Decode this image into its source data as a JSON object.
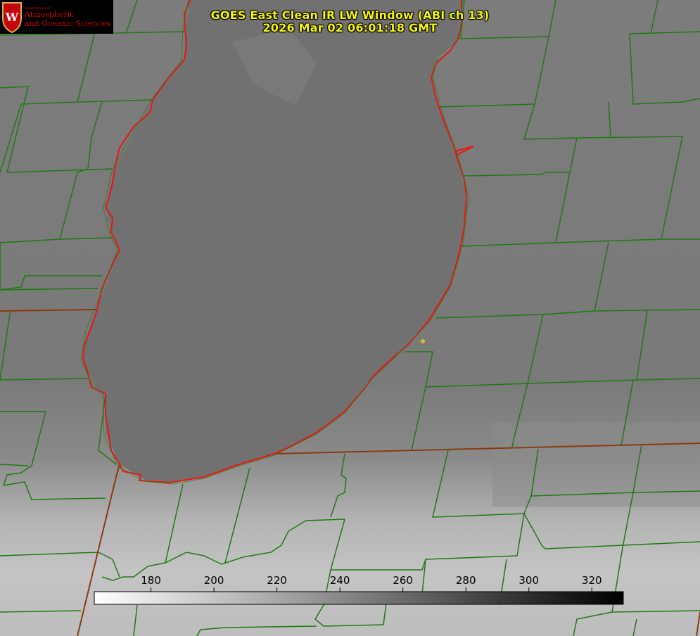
{
  "title": {
    "line1": "GOES East Clean IR LW Window (ABI ch 13)",
    "line2": "2026 Mar 02 06:01:18 GMT"
  },
  "logo": {
    "small_text": "Department of",
    "line1": "Atmospheric",
    "line2": "and Oceanic Sciences",
    "crest_letter": "W"
  },
  "colorbar": {
    "ticks": [
      "180",
      "200",
      "220",
      "240",
      "260",
      "280",
      "300",
      "320"
    ],
    "range_min": 162,
    "range_max": 330,
    "gradient": "white-to-black"
  },
  "colors": {
    "county_lines": "#1f7a12",
    "lake_shoreline": "#e8170f",
    "state_border": "#8a3a12",
    "title_text": "#f2f20a",
    "station_marker": "#d6c21a",
    "logo_red": "#c5050c"
  },
  "map_features": [
    "lake-michigan-shoreline",
    "county-boundaries",
    "state-borders",
    "station-marker"
  ]
}
